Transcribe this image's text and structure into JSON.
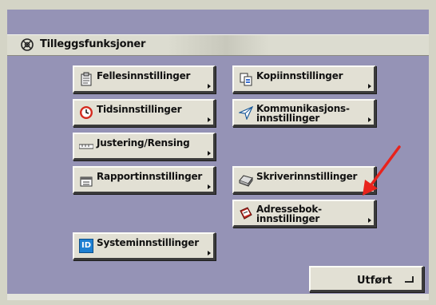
{
  "header": {
    "title": "Tilleggsfunksjoner",
    "icon": "settings-gears-icon"
  },
  "buttons": {
    "felles": {
      "label": "Fellesinnstillinger",
      "icon": "clipboard-icon"
    },
    "tids": {
      "label": "Tidsinnstillinger",
      "icon": "clock-icon"
    },
    "justering": {
      "label": "Justering/Rensing",
      "icon": "ruler-icon"
    },
    "rapport": {
      "label": "Rapportinnstillinger",
      "icon": "report-icon"
    },
    "system": {
      "label": "Systeminnstillinger",
      "icon": "id-badge-icon",
      "icon_text": "ID"
    },
    "kopi": {
      "label": "Kopiinnstillinger",
      "icon": "copy-pages-icon"
    },
    "kommunikasjon": {
      "label_line1": "Kommunikasjons-",
      "label_line2": "innstillinger",
      "icon": "paper-plane-icon"
    },
    "skriver": {
      "label": "Skriverinnstillinger",
      "icon": "printer-icon"
    },
    "adressebok": {
      "label_line1": "Adressebok-",
      "label_line2": "innstillinger",
      "icon": "address-book-icon"
    }
  },
  "footer": {
    "done_label": "Utført",
    "done_icon": "enter-return-icon"
  },
  "annotation": {
    "color": "#e8231c",
    "points_to": "Skriverinnstillinger"
  },
  "colors": {
    "screen_bg": "#9593b6",
    "button_bg": "#e2e0d4",
    "titlebar_bg": "#dcdcd0"
  }
}
